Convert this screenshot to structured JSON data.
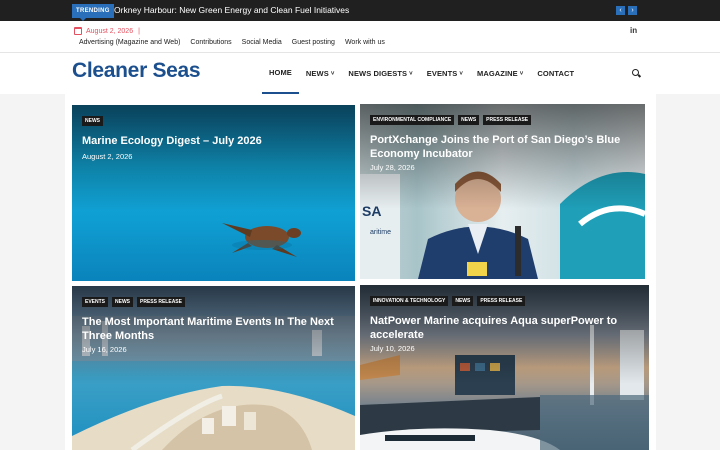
{
  "trending": {
    "badge": "TRENDING",
    "headline": "Orkney Harbour: New Green Energy and Clean Fuel Initiatives",
    "prev": "‹",
    "next": "›"
  },
  "topbar": {
    "date": "August 2, 2026",
    "separator": "|",
    "links": [
      "Advertising (Magazine and Web)",
      "Contributions",
      "Social Media",
      "Guest posting",
      "Work with us"
    ],
    "social": "in"
  },
  "header": {
    "logo": "Cleaner Seas",
    "nav": [
      {
        "label": "HOME",
        "dropdown": false,
        "active": true
      },
      {
        "label": "NEWS",
        "dropdown": true
      },
      {
        "label": "NEWS DIGESTS",
        "dropdown": true
      },
      {
        "label": "EVENTS",
        "dropdown": true
      },
      {
        "label": "MAGAZINE",
        "dropdown": true
      },
      {
        "label": "CONTACT",
        "dropdown": false
      }
    ],
    "chevron": "˅"
  },
  "cards": [
    {
      "tags": [
        "NEWS"
      ],
      "title": "Marine Ecology Digest – July 2026",
      "date": "August 2, 2026"
    },
    {
      "tags": [
        "ENVIRONMENTAL COMPLIANCE",
        "NEWS",
        "PRESS RELEASE"
      ],
      "title": "PortXchange Joins the Port of San Diego’s Blue Economy Incubator",
      "date": "July 28, 2026"
    },
    {
      "tags": [
        "EVENTS",
        "NEWS",
        "PRESS RELEASE"
      ],
      "title": "The Most Important Maritime Events In The Next Three Months",
      "date": "July 16, 2026"
    },
    {
      "tags": [
        "INNOVATION & TECHNOLOGY",
        "NEWS",
        "PRESS RELEASE"
      ],
      "title": "NatPower Marine acquires Aqua superPower to accelerate",
      "date": "July 10, 2026"
    }
  ]
}
